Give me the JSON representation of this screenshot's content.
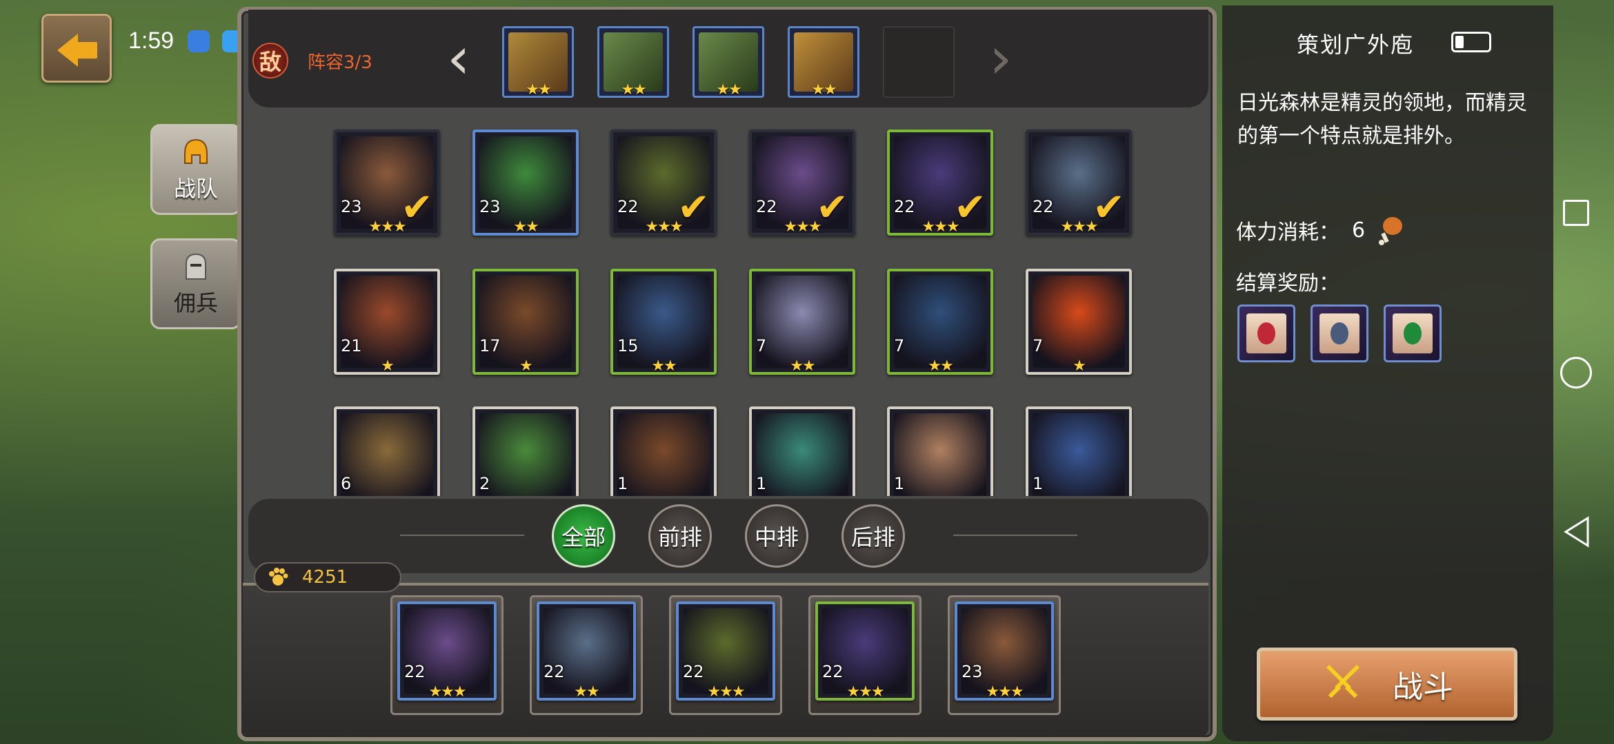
{
  "status_bar": {
    "time": "1:59",
    "notif_text": "策划广外庖"
  },
  "header": {
    "enemy_badge": "敌",
    "lineup_label": "阵容3/3"
  },
  "enemy_lineup": [
    {
      "stars": "★★"
    },
    {
      "stars": "★★"
    },
    {
      "stars": "★★"
    },
    {
      "stars": "★★"
    }
  ],
  "side_tabs": [
    {
      "label": "战队",
      "active": true
    },
    {
      "label": "佣兵",
      "active": false
    }
  ],
  "heroes": [
    {
      "level": "23",
      "stars": "★★★",
      "selected": true,
      "frame": "dark",
      "color": "#8a5a3a"
    },
    {
      "level": "23",
      "stars": "★★",
      "selected": false,
      "frame": "blue",
      "color": "#3f8a3c"
    },
    {
      "level": "22",
      "stars": "★★★",
      "selected": true,
      "frame": "dark",
      "color": "#5c6b2b"
    },
    {
      "level": "22",
      "stars": "★★★",
      "selected": true,
      "frame": "dark",
      "color": "#6a4c8a"
    },
    {
      "level": "22",
      "stars": "★★★",
      "selected": true,
      "frame": "green",
      "color": "#4a3b7a"
    },
    {
      "level": "22",
      "stars": "★★★",
      "selected": true,
      "frame": "dark",
      "color": "#5a6f88"
    },
    {
      "level": "21",
      "stars": "★",
      "selected": false,
      "frame": "white",
      "color": "#9a4a2a"
    },
    {
      "level": "17",
      "stars": "★",
      "selected": false,
      "frame": "green",
      "color": "#7a4a2a"
    },
    {
      "level": "15",
      "stars": "★★",
      "selected": false,
      "frame": "green",
      "color": "#3a5a8a"
    },
    {
      "level": "7",
      "stars": "★★",
      "selected": false,
      "frame": "green",
      "color": "#8a8ab0"
    },
    {
      "level": "7",
      "stars": "★★",
      "selected": false,
      "frame": "green",
      "color": "#2f4f7a"
    },
    {
      "level": "7",
      "stars": "★",
      "selected": false,
      "frame": "white",
      "color": "#d84a1a"
    },
    {
      "level": "6",
      "stars": "",
      "selected": false,
      "frame": "white",
      "color": "#8a6a3a"
    },
    {
      "level": "2",
      "stars": "",
      "selected": false,
      "frame": "white",
      "color": "#4a8a3a"
    },
    {
      "level": "1",
      "stars": "",
      "selected": false,
      "frame": "white",
      "color": "#7a4a2a"
    },
    {
      "level": "1",
      "stars": "",
      "selected": false,
      "frame": "white",
      "color": "#3a8a7a"
    },
    {
      "level": "1",
      "stars": "",
      "selected": false,
      "frame": "white",
      "color": "#b08060"
    },
    {
      "level": "1",
      "stars": "",
      "selected": false,
      "frame": "white",
      "color": "#3a5a9a"
    }
  ],
  "filters": [
    {
      "label": "全部",
      "active": true
    },
    {
      "label": "前排",
      "active": false
    },
    {
      "label": "中排",
      "active": false
    },
    {
      "label": "后排",
      "active": false
    }
  ],
  "power": {
    "value": "4251"
  },
  "team": [
    {
      "level": "22",
      "stars": "★★★",
      "frame": "blue",
      "color": "#6a4c8a"
    },
    {
      "level": "22",
      "stars": "★★",
      "frame": "blue",
      "color": "#5a6f88"
    },
    {
      "level": "22",
      "stars": "★★★",
      "frame": "blue",
      "color": "#5c6b2b"
    },
    {
      "level": "22",
      "stars": "★★★",
      "frame": "green",
      "color": "#4a3b7a"
    },
    {
      "level": "23",
      "stars": "★★★",
      "frame": "blue",
      "color": "#8a5a3a"
    }
  ],
  "info": {
    "description": "日光森林是精灵的领地，而精灵的第一个特点就是排外。",
    "stamina_label": "体力消耗：",
    "stamina_value": "6",
    "reward_label": "结算奖励：",
    "rewards": [
      {
        "gem": "#c02838"
      },
      {
        "gem": "#4a5a7a"
      },
      {
        "gem": "#1e8a3a"
      }
    ]
  },
  "fight_button": {
    "label": "战斗"
  }
}
